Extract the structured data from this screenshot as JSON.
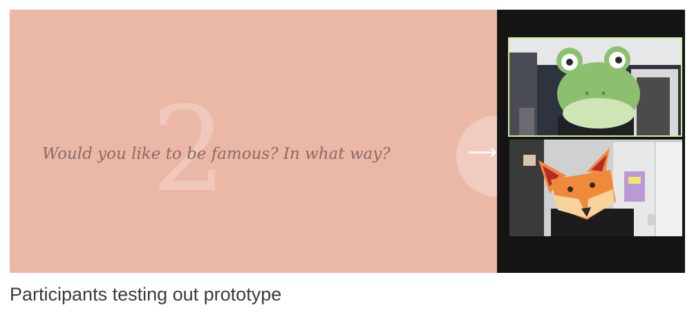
{
  "slide": {
    "number": "2",
    "question": "Would you like to be famous? In what way?",
    "next_icon": "right-arrow-icon",
    "background": "#ebb8a8"
  },
  "video": {
    "participants": [
      {
        "avatar": "frog-face-icon",
        "active_speaker": true
      },
      {
        "avatar": "fox-face-icon",
        "active_speaker": false
      }
    ],
    "active_border_color": "#d3ef9f"
  },
  "caption": "Participants testing out prototype"
}
